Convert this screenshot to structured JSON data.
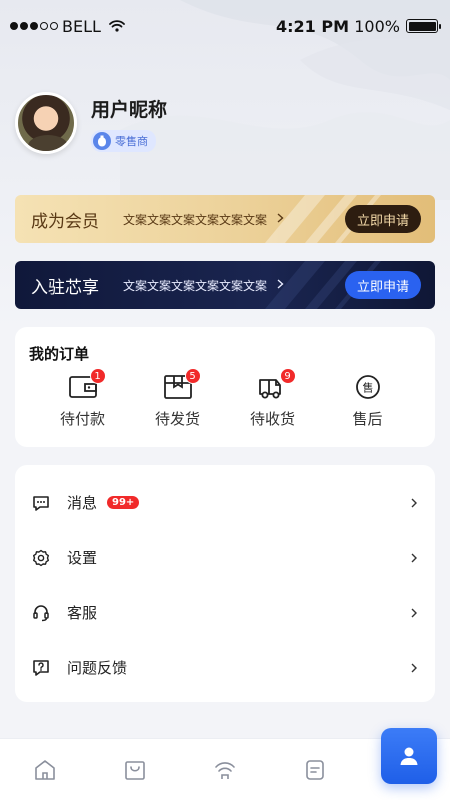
{
  "status": {
    "carrier": "BELL",
    "time": "4:21 PM",
    "battery": "100%",
    "signal_dots": [
      true,
      true,
      true,
      false,
      false
    ],
    "battery_level": 1.0
  },
  "profile": {
    "nickname": "用户昵称",
    "role": "零售商"
  },
  "vip_banner": {
    "title": "成为会员",
    "desc": "文案文案文案文案文案文案",
    "button": "立即申请"
  },
  "join_banner": {
    "title": "入驻芯享",
    "desc": "文案文案文案文案文案文案",
    "button": "立即申请"
  },
  "orders": {
    "title": "我的订单",
    "items": [
      {
        "label": "待付款",
        "badge": "1",
        "icon": "wallet-icon"
      },
      {
        "label": "待发货",
        "badge": "5",
        "icon": "package-icon"
      },
      {
        "label": "待收货",
        "badge": "9",
        "icon": "truck-icon"
      },
      {
        "label": "售后",
        "badge": "",
        "icon": "after-sales-icon",
        "icon_text": "售"
      }
    ]
  },
  "menu": {
    "items": [
      {
        "label": "消息",
        "badge": "99+",
        "icon": "message-icon"
      },
      {
        "label": "设置",
        "badge": "",
        "icon": "gear-icon"
      },
      {
        "label": "客服",
        "badge": "",
        "icon": "headset-icon"
      },
      {
        "label": "问题反馈",
        "badge": "",
        "icon": "feedback-icon"
      }
    ]
  },
  "tabbar": {
    "tabs": [
      "home-icon",
      "bag-icon",
      "signal-icon",
      "document-icon",
      "user-icon"
    ],
    "active_index": 4
  },
  "colors": {
    "accent": "#2a62f0",
    "badge_red": "#f12a2a",
    "vip_gold": "#ecd199",
    "join_navy": "#10183a"
  }
}
